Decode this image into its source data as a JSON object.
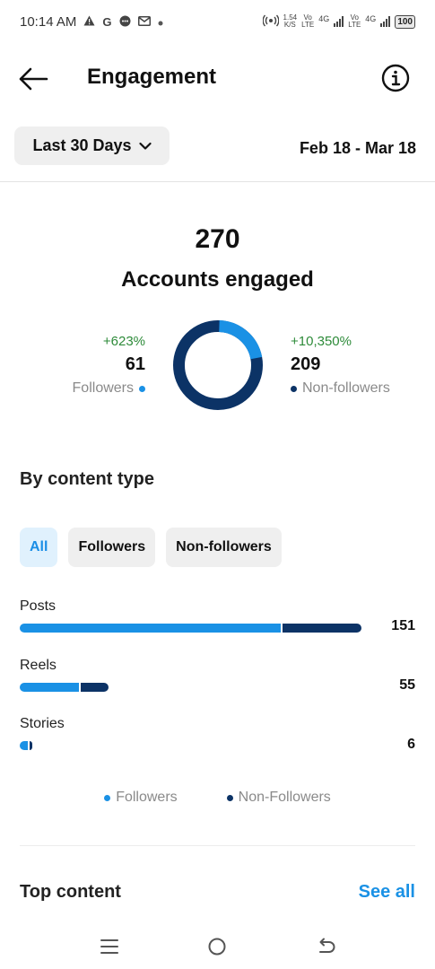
{
  "status_bar": {
    "time": "10:14 AM",
    "notif_icons": [
      "warning-icon",
      "google-icon",
      "message-icon",
      "gmail-icon"
    ],
    "net_speed_value": "1.54",
    "net_speed_unit": "K/S",
    "volte1_top": "Vo",
    "volte1_bottom": "LTE",
    "net_4g_1": "4G",
    "volte2_top": "Vo",
    "volte2_bottom": "LTE",
    "net_4g_2": "4G",
    "battery": "100"
  },
  "header": {
    "title": "Engagement"
  },
  "date_filter": {
    "range_label": "Last 30 Days",
    "date_range": "Feb 18 - Mar 18"
  },
  "summary": {
    "total": "270",
    "label": "Accounts engaged",
    "followers": {
      "change": "+623%",
      "count": "61",
      "label": "Followers",
      "color": "#1a91e5"
    },
    "non_followers": {
      "change": "+10,350%",
      "count": "209",
      "label": "Non-followers",
      "color": "#0c3366"
    },
    "donut_followers_fraction": 0.226
  },
  "content_type": {
    "title": "By content type",
    "filters": [
      "All",
      "Followers",
      "Non-followers"
    ],
    "active_filter": "All",
    "rows": [
      {
        "label": "Posts",
        "value": "151",
        "followers_fraction": 0.66,
        "nonfollowers_fraction": 0.2
      },
      {
        "label": "Reels",
        "value": "55",
        "followers_fraction": 0.15,
        "nonfollowers_fraction": 0.07
      },
      {
        "label": "Stories",
        "value": "6",
        "followers_fraction": 0.02,
        "nonfollowers_fraction": 0.005
      }
    ],
    "legend": [
      "Followers",
      "Non-Followers"
    ]
  },
  "top_content": {
    "title": "Top content",
    "see_all": "See all"
  },
  "colors": {
    "followers": "#1a91e5",
    "non_followers": "#0c3366",
    "positive_change": "#2e8b3a",
    "link": "#1a91e5"
  }
}
